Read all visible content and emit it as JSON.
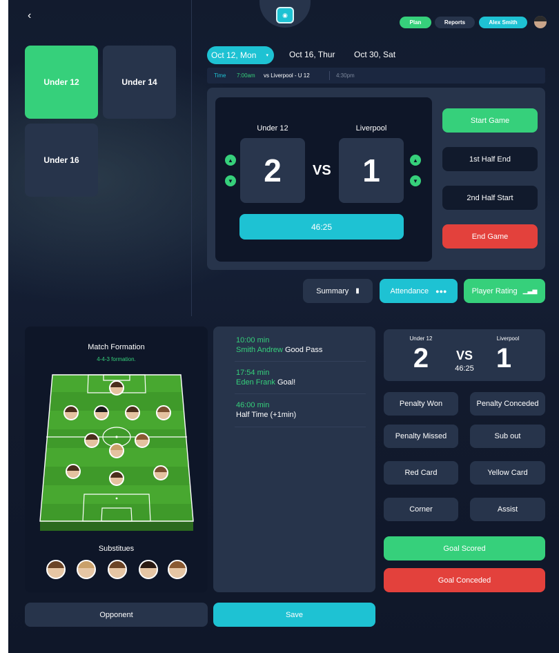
{
  "header": {
    "nav_pills": [
      "Plan",
      "Reports",
      "Alex Smith"
    ]
  },
  "teams": [
    {
      "label": "Under 12",
      "selected": true
    },
    {
      "label": "Under 14",
      "selected": false
    },
    {
      "label": "Under 16",
      "selected": false
    }
  ],
  "dates": [
    {
      "label": "Oct 12, Mon",
      "selected": true
    },
    {
      "label": "Oct 16, Thur",
      "selected": false
    },
    {
      "label": "Oct 30, Sat",
      "selected": false
    }
  ],
  "fixture_bar": {
    "time_label": "Time",
    "time": "7:00am",
    "match": "vs Liverpool - U 12",
    "end_time": "4:30pm"
  },
  "scoreboard": {
    "home_team": "Under 12",
    "away_team": "Liverpool",
    "home_score": "2",
    "away_score": "1",
    "vs": "VS",
    "clock": "46:25"
  },
  "game_controls": [
    "Start Game",
    "1st Half End",
    "2nd Half Start",
    "End Game"
  ],
  "tabs": [
    {
      "label": "Summary",
      "icon": "clipboard-icon"
    },
    {
      "label": "Attendance",
      "icon": "group-icon"
    },
    {
      "label": "Player Rating",
      "icon": "bar-chart-icon"
    }
  ],
  "formation": {
    "title": "Match Formation",
    "subtitle": "4-4-3 formation.",
    "substitutes_label": "Substitues"
  },
  "feed": [
    {
      "time": "10:00 min",
      "player": "Smith Andrew",
      "event": "Good Pass"
    },
    {
      "time": "17:54 min",
      "player": "Eden Frank",
      "event": "Goal!"
    },
    {
      "time": "46:00 min",
      "player": "",
      "event": "Half Time (+1min)"
    }
  ],
  "mini_score": {
    "home_team": "Under 12",
    "away_team": "Liverpool",
    "home_score": "2",
    "away_score": "1",
    "vs": "VS",
    "clock": "46:25"
  },
  "event_buttons": [
    "Penalty Won",
    "Penalty Conceded",
    "Penalty Missed",
    "Sub out",
    "Red Card",
    "Yellow Card",
    "Corner",
    "Assist"
  ],
  "goal_buttons": [
    "Goal Scored",
    "Goal Conceded"
  ],
  "bottom": {
    "opponent": "Opponent",
    "save": "Save"
  },
  "colors": {
    "green": "#36d07b",
    "cyan": "#1ec2d3",
    "red": "#e3413c",
    "panel": "#27344b",
    "background": "#121b2e"
  }
}
